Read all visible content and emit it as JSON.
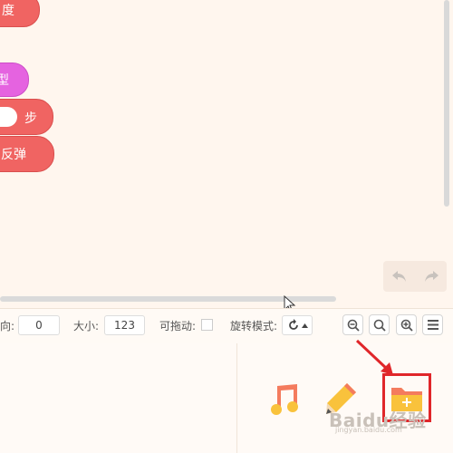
{
  "blocks": [
    {
      "label": "度",
      "color": "#f06462"
    },
    {
      "label": "型",
      "color": "#e563e0"
    },
    {
      "label": "步",
      "color": "#f06462"
    },
    {
      "label": "反弹",
      "color": "#f06462"
    }
  ],
  "properties": {
    "direction_label": "向:",
    "direction_value": "0",
    "size_label": "大小:",
    "size_value": "123",
    "draggable_label": "可拖动:",
    "rotation_label": "旋转模式:"
  },
  "icons": {
    "undo": "undo-icon",
    "redo": "redo-icon",
    "rotation": "rotate-icon",
    "zoom_out": "zoom-out-icon",
    "zoom_reset": "zoom-reset-icon",
    "zoom_in": "zoom-in-icon",
    "menu": "menu-icon",
    "music": "music-icon",
    "pencil": "pencil-icon",
    "folder_add": "folder-add-icon"
  },
  "watermark": {
    "text": "Baidu经验",
    "url": "jingyan.baidu.com"
  },
  "colors": {
    "block_red": "#f06462",
    "block_purple": "#e563e0",
    "highlight": "#e0262a",
    "background": "#fff6ee"
  }
}
